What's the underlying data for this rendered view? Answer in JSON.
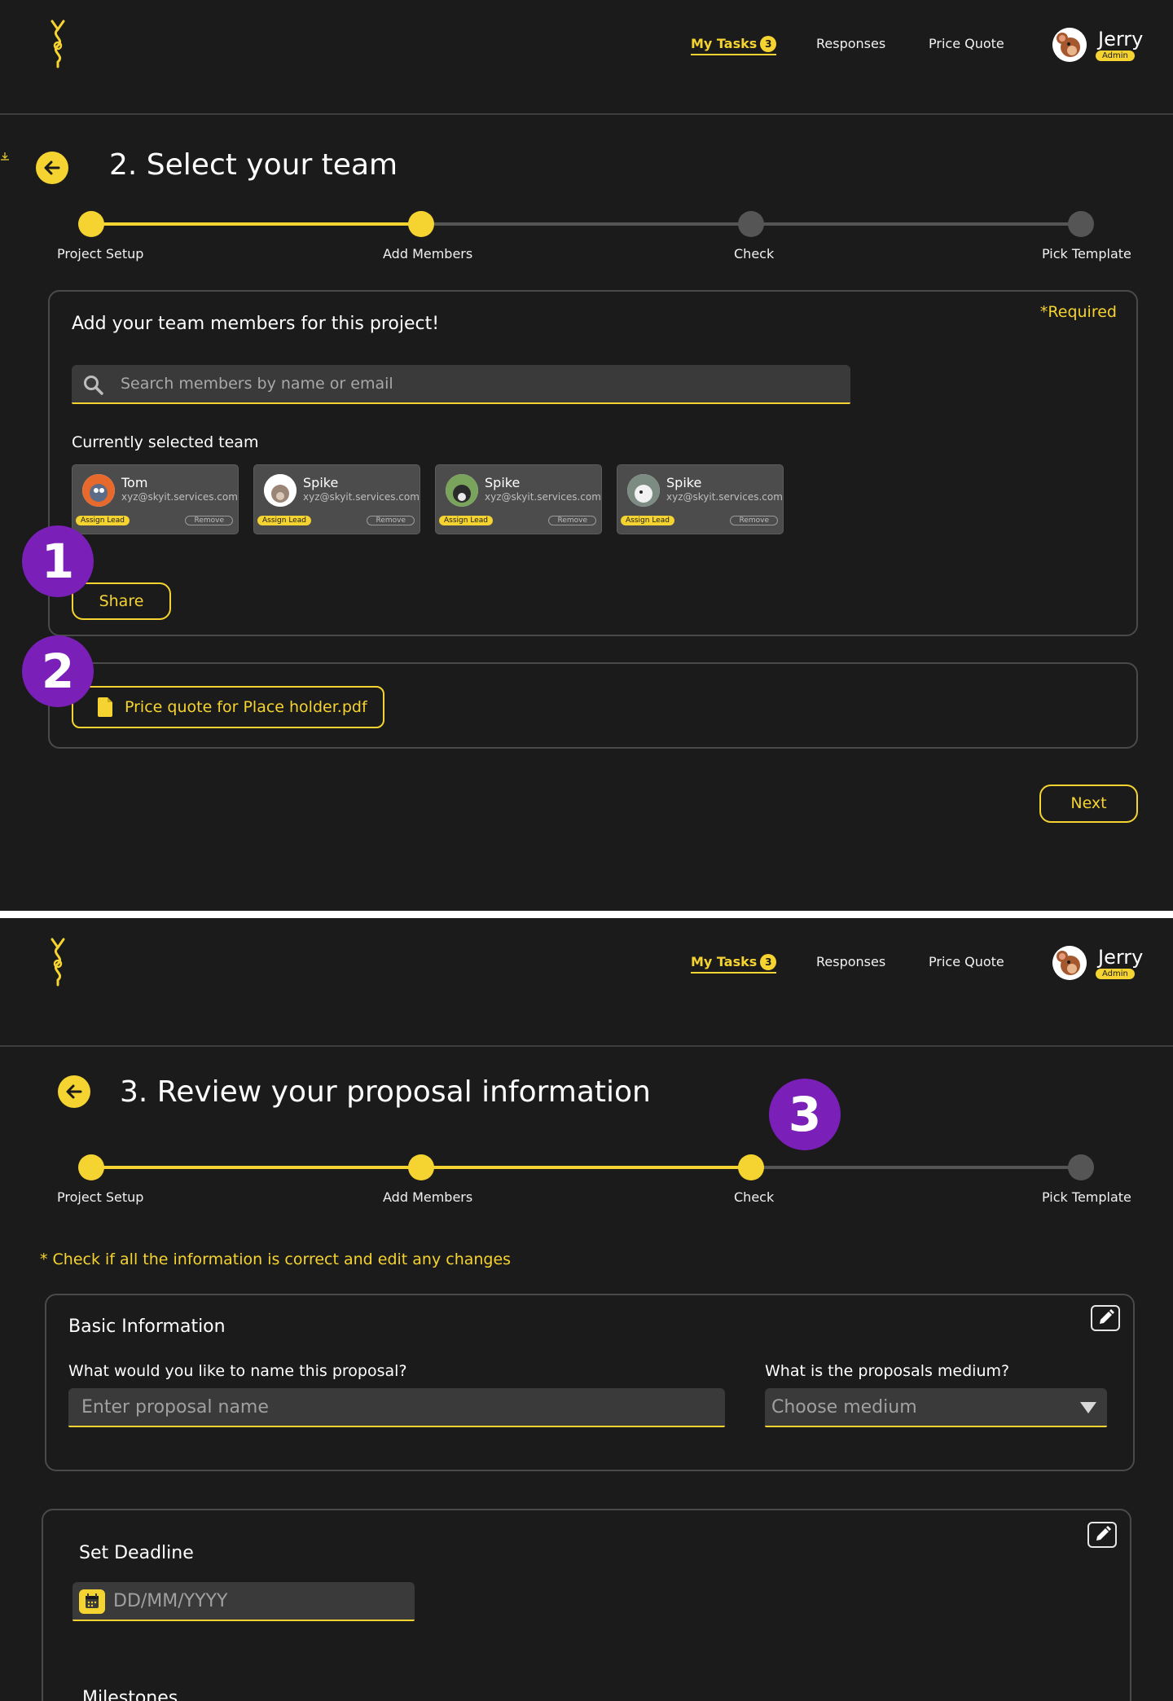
{
  "header": {
    "nav": [
      {
        "label": "My Tasks",
        "badge": "3",
        "active": true
      },
      {
        "label": "Responses"
      },
      {
        "label": "Price Quote"
      }
    ],
    "user": {
      "name": "Jerry",
      "role": "Admin"
    }
  },
  "screen1": {
    "title": "2. Select your team",
    "steps": [
      "Project Setup",
      "Add Members",
      "Check",
      "Pick Template"
    ],
    "current_step": 2,
    "panel": {
      "heading": "Add your team members for this project!",
      "required": "*Required",
      "search_placeholder": "Search members by name or email",
      "selected_label": "Currently selected team",
      "members": [
        {
          "name": "Tom",
          "email": "xyz@skyit.services.com",
          "lead": "Assign Lead",
          "remove": "Remove"
        },
        {
          "name": "Spike",
          "email": "xyz@skyit.services.com",
          "lead": "Assign Lead",
          "remove": "Remove"
        },
        {
          "name": "Spike",
          "email": "xyz@skyit.services.com",
          "lead": "Assign Lead",
          "remove": "Remove"
        },
        {
          "name": "Spike",
          "email": "xyz@skyit.services.com",
          "lead": "Assign Lead",
          "remove": "Remove"
        }
      ],
      "share_label": "Share"
    },
    "attachment": "Price quote for Place holder.pdf",
    "next_label": "Next",
    "markers": [
      "1",
      "2"
    ]
  },
  "screen2": {
    "title": "3. Review your proposal information",
    "steps": [
      "Project Setup",
      "Add Members",
      "Check",
      "Pick Template"
    ],
    "current_step": 3,
    "marker": "3",
    "notice": "* Check if all the information is correct and edit any changes",
    "basic": {
      "heading": "Basic Information",
      "name_label": "What would you like to name this proposal?",
      "name_placeholder": "Enter proposal name",
      "medium_label": "What is the proposals medium?",
      "medium_value": "Choose medium"
    },
    "deadline": {
      "heading": "Set Deadline",
      "date_placeholder": "DD/MM/YYYY",
      "milestones_heading": "Milestones"
    }
  },
  "colors": {
    "accent": "#f5d330",
    "background": "#1b1b1b",
    "marker": "#7a1fb8",
    "panel_border": "#4a4a4a"
  }
}
